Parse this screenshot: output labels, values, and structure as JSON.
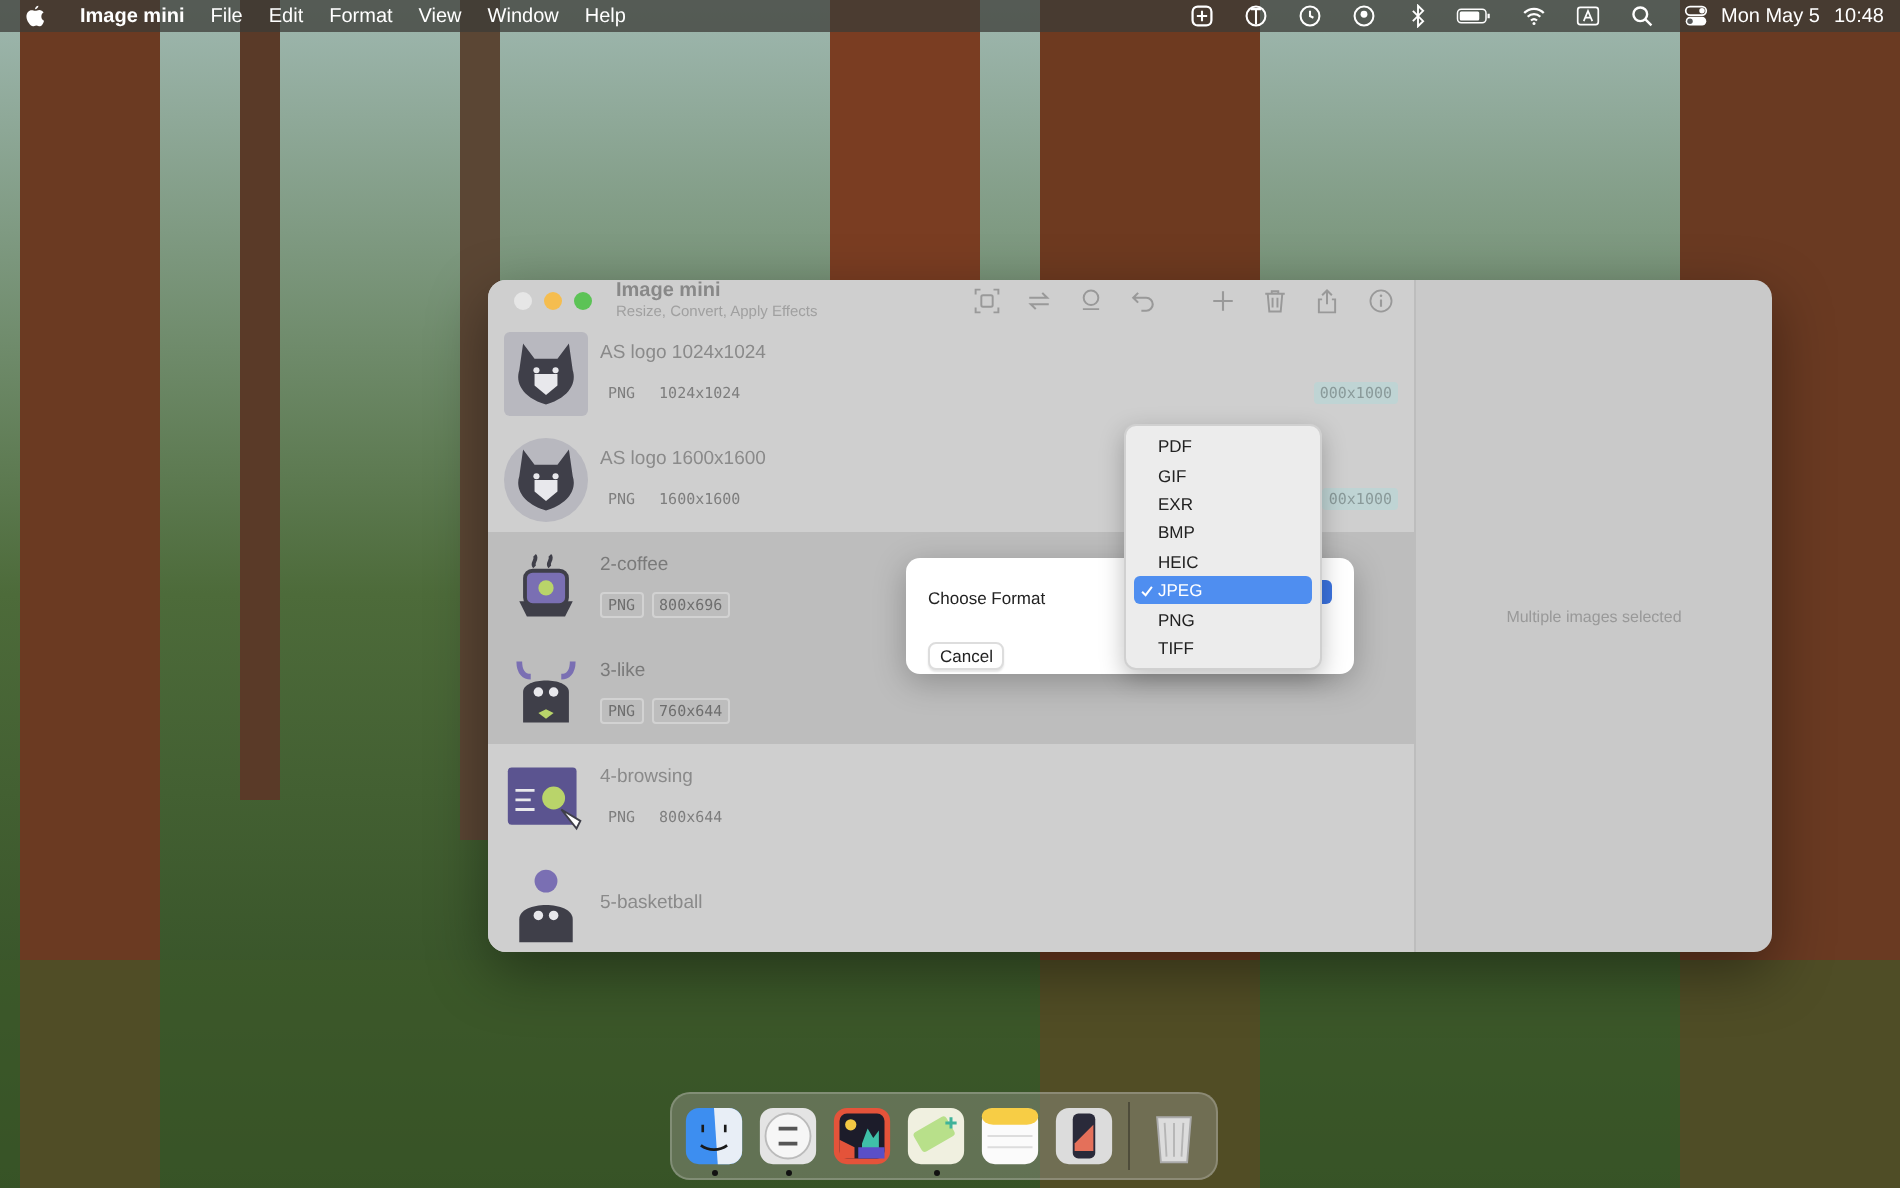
{
  "menu_bar": {
    "app_name": "Image mini",
    "menus": [
      "File",
      "Edit",
      "Format",
      "View",
      "Window",
      "Help"
    ],
    "date": "Mon May 5",
    "time": "10:48"
  },
  "window": {
    "title": "Image mini",
    "subtitle": "Resize, Convert, Apply Effects",
    "rows": [
      {
        "name": "AS logo 1024x1024",
        "format": "PNG",
        "size": "1024x1024",
        "target": "000x1000",
        "selected": false
      },
      {
        "name": "AS logo 1600x1600",
        "format": "PNG",
        "size": "1600x1600",
        "target": "00x1000",
        "selected": false
      },
      {
        "name": "2-coffee",
        "format": "PNG",
        "size": "800x696",
        "selected": true
      },
      {
        "name": "3-like",
        "format": "PNG",
        "size": "760x644",
        "selected": true
      },
      {
        "name": "4-browsing",
        "format": "PNG",
        "size": "800x644",
        "selected": false
      },
      {
        "name": "5-basketball",
        "selected": false
      }
    ],
    "detail_text": "Multiple images selected"
  },
  "dialog": {
    "label": "Choose Format",
    "cancel": "Cancel",
    "options": [
      {
        "label": "PDF",
        "selected": false
      },
      {
        "label": "GIF",
        "selected": false
      },
      {
        "label": "EXR",
        "selected": false
      },
      {
        "label": "BMP",
        "selected": false
      },
      {
        "label": "HEIC",
        "selected": false
      },
      {
        "label": "JPEG",
        "selected": true
      },
      {
        "label": "PNG",
        "selected": false
      },
      {
        "label": "TIFF",
        "selected": false
      }
    ]
  },
  "dock": [
    {
      "running": true
    },
    {
      "running": true
    },
    {
      "running": false
    },
    {
      "running": true
    },
    {
      "running": false
    },
    {
      "running": false
    },
    {
      "running": false
    }
  ]
}
